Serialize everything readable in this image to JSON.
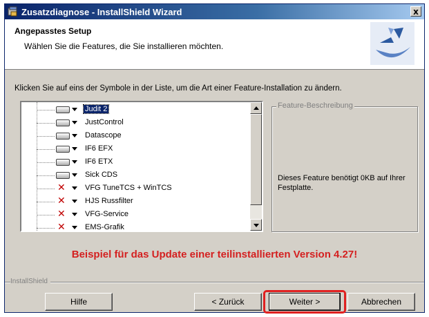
{
  "window": {
    "title": "Zusatzdiagnose - InstallShield Wizard",
    "close_label": "x"
  },
  "header": {
    "title": "Angepasstes Setup",
    "subtitle": "Wählen Sie die Features, die Sie installieren möchten."
  },
  "instruction": "Klicken Sie auf eins der Symbole in der Liste, um die Art einer Feature-Installation zu ändern.",
  "features": [
    {
      "label": "Judit 2",
      "state": "install",
      "selected": true
    },
    {
      "label": "JustControl",
      "state": "install"
    },
    {
      "label": "Datascope",
      "state": "install"
    },
    {
      "label": "IF6 EFX",
      "state": "install"
    },
    {
      "label": "IF6 ETX",
      "state": "install"
    },
    {
      "label": "Sick CDS",
      "state": "install"
    },
    {
      "label": "VFG TuneTCS + WinTCS",
      "state": "not-installed"
    },
    {
      "label": "HJS Russfilter",
      "state": "not-installed"
    },
    {
      "label": "VFG-Service",
      "state": "not-installed"
    },
    {
      "label": "EMS-Grafik",
      "state": "not-installed"
    }
  ],
  "description": {
    "legend": "Feature-Beschreibung",
    "text": "Dieses Feature benötigt 0KB auf Ihrer Festplatte."
  },
  "banner": "Beispiel für das Update einer teilinstallierten Version 4.27!",
  "brand": "InstallShield",
  "buttons": {
    "help": "Hilfe",
    "back": "< Zurück",
    "next": "Weiter >",
    "cancel": "Abbrechen"
  },
  "colors": {
    "banner": "#d42020",
    "highlight": "#e02020",
    "titlebar": "#0a246a"
  }
}
